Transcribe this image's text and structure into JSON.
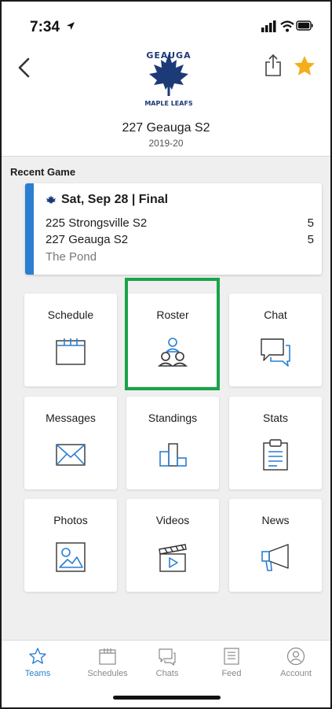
{
  "status_bar": {
    "time": "7:34"
  },
  "header": {
    "logo_top_text": "GEAUGA",
    "logo_bottom_text": "MAPLE LEAFS",
    "team_name": "227 Geauga S2",
    "season": "2019-20"
  },
  "recent_game": {
    "section_label": "Recent Game",
    "date_status": "Sat, Sep 28 | Final",
    "teams": [
      {
        "name": "225 Strongsville S2",
        "score": "5"
      },
      {
        "name": "227 Geauga S2",
        "score": "5"
      }
    ],
    "venue": "The Pond"
  },
  "tiles": [
    {
      "label": "Schedule",
      "icon": "calendar-icon"
    },
    {
      "label": "Roster",
      "icon": "roster-people-icon"
    },
    {
      "label": "Chat",
      "icon": "chat-bubbles-icon"
    },
    {
      "label": "Messages",
      "icon": "envelope-icon"
    },
    {
      "label": "Standings",
      "icon": "podium-icon"
    },
    {
      "label": "Stats",
      "icon": "clipboard-icon"
    },
    {
      "label": "Photos",
      "icon": "photo-icon"
    },
    {
      "label": "Videos",
      "icon": "clapperboard-icon"
    },
    {
      "label": "News",
      "icon": "megaphone-icon"
    }
  ],
  "tab_bar": [
    {
      "label": "Teams",
      "icon": "star-outline-icon",
      "active": true
    },
    {
      "label": "Schedules",
      "icon": "calendar-icon",
      "active": false
    },
    {
      "label": "Chats",
      "icon": "chat-icon",
      "active": false
    },
    {
      "label": "Feed",
      "icon": "feed-icon",
      "active": false
    },
    {
      "label": "Account",
      "icon": "account-icon",
      "active": false
    }
  ],
  "colors": {
    "accent_blue": "#2a7fd0",
    "star_gold": "#f4ae1a",
    "highlight_green": "#19a34a",
    "logo_navy": "#1d3a78"
  }
}
